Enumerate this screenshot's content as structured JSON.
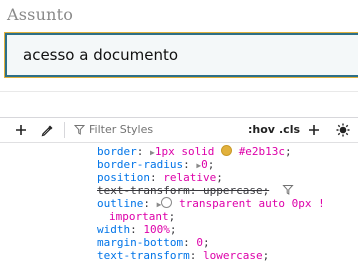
{
  "page": {
    "field_label": "Assunto",
    "field_value": "acesso a documento",
    "accent_border": "#e2b13c",
    "focus_ring": "#2d6f87"
  },
  "devtools": {
    "toolbar": {
      "add_rule_icon": "plus-icon",
      "eyedropper_icon": "eyedropper-icon",
      "filter_placeholder": "Filter Styles",
      "hov_label": ":hov",
      "cls_label": ".cls",
      "add_icon": "plus-icon",
      "theme_icon": "sun-icon"
    },
    "declarations": [
      {
        "prop": "border",
        "value": "1px solid #e2b13c",
        "v1": "1px solid ",
        "v2": "#e2b13c"
      },
      {
        "prop": "border-radius",
        "value": "0"
      },
      {
        "prop": "position",
        "value": "relative"
      },
      {
        "prop": "text-transform",
        "value": "uppercase",
        "overridden": true
      },
      {
        "prop": "outline",
        "v1": "transparent auto 0px !"
      },
      {
        "continuation": "important"
      },
      {
        "prop": "width",
        "value": "100%"
      },
      {
        "prop": "margin-bottom",
        "value": "0"
      },
      {
        "prop": "text-transform",
        "value": "lowercase"
      }
    ]
  }
}
